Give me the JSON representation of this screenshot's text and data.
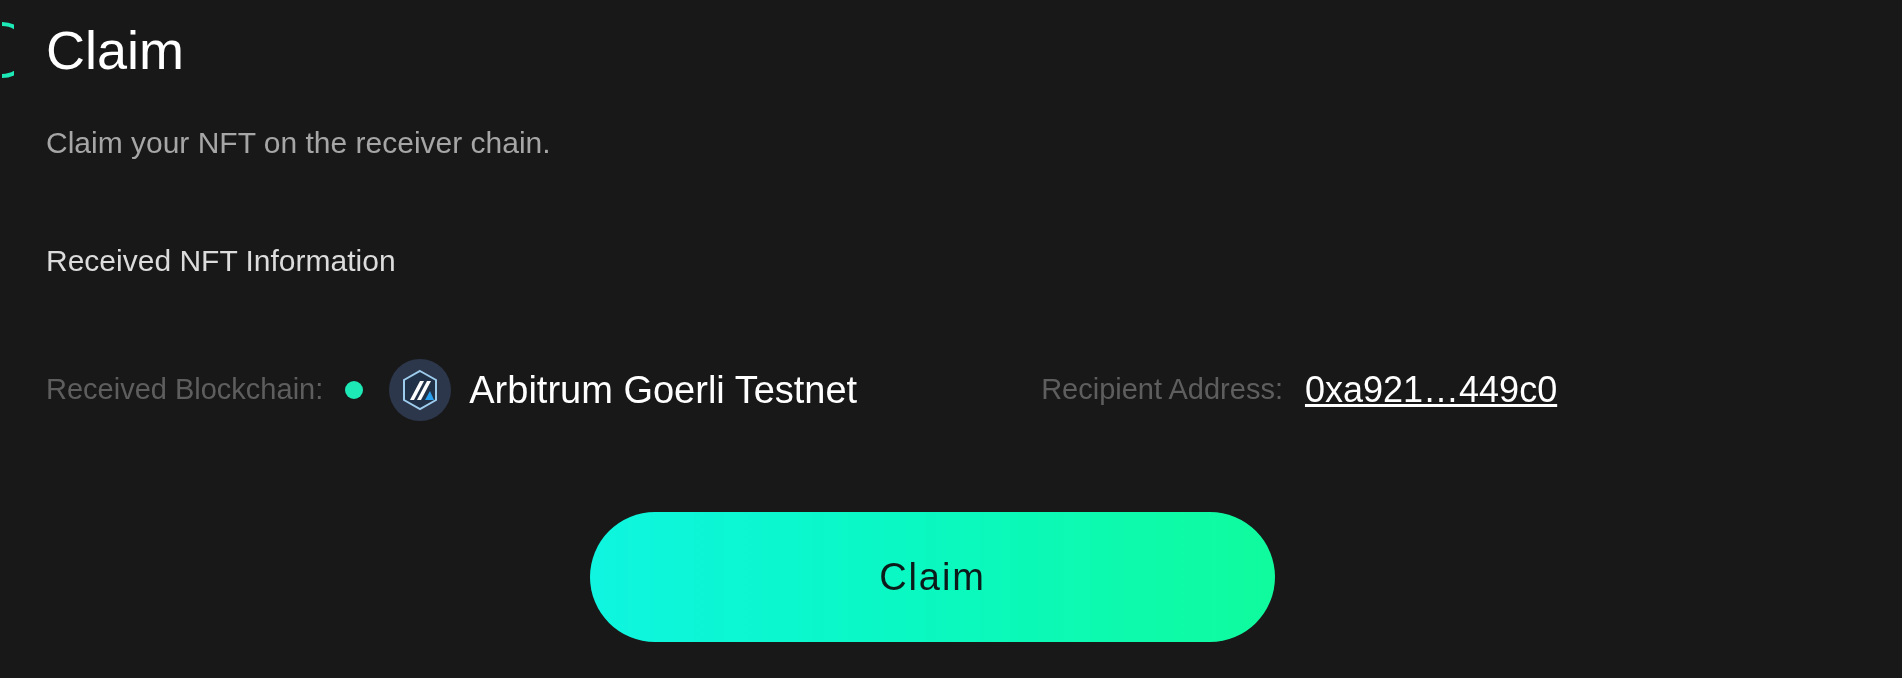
{
  "step": {
    "title": "Claim",
    "description": "Claim your NFT on the receiver chain."
  },
  "section": {
    "title": "Received NFT Information"
  },
  "blockchain": {
    "label": "Received Blockchain:",
    "color": "#1de9b6",
    "name": "Arbitrum Goerli Testnet"
  },
  "recipient": {
    "label": "Recipient Address:",
    "address": "0xa921…449c0"
  },
  "button": {
    "label": "Claim"
  }
}
